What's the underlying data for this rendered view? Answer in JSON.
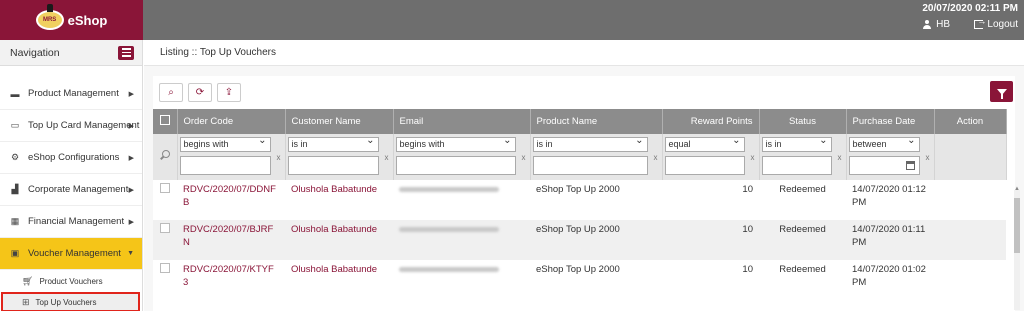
{
  "brand": {
    "badge": "MRS",
    "name": "eShop"
  },
  "header": {
    "datetime": "20/07/2020 02:11 PM",
    "user": "HB",
    "logout_label": "Logout"
  },
  "nav": {
    "title": "Navigation",
    "items": [
      {
        "label": "Product Management",
        "icon": "box-icon"
      },
      {
        "label": "Top Up Card Management",
        "icon": "card-icon"
      },
      {
        "label": "eShop Configurations",
        "icon": "gear-icon"
      },
      {
        "label": "Corporate Management",
        "icon": "chart-icon"
      },
      {
        "label": "Financial Management",
        "icon": "grid-icon"
      },
      {
        "label": "Voucher Management",
        "icon": "voucher-icon"
      }
    ],
    "sub_items": [
      {
        "label": "Product Vouchers",
        "icon": "cart-icon"
      },
      {
        "label": "Top Up Vouchers",
        "icon": "gift-icon"
      }
    ]
  },
  "breadcrumb": "Listing :: Top Up Vouchers",
  "table": {
    "columns": [
      "Order Code",
      "Customer Name",
      "Email",
      "Product Name",
      "Reward Points",
      "Status",
      "Purchase Date",
      "Action"
    ],
    "filters": [
      "begins with",
      "is in",
      "begins with",
      "is in",
      "equal",
      "is in",
      "between"
    ],
    "rows": [
      {
        "code": "RDVC/2020/07/DDNFB",
        "customer": "Olushola Babatunde",
        "product": "eShop Top Up 2000",
        "points": "10",
        "status": "Redeemed",
        "date": "14/07/2020 01:12 PM"
      },
      {
        "code": "RDVC/2020/07/BJRFN",
        "customer": "Olushola Babatunde",
        "product": "eShop Top Up 2000",
        "points": "10",
        "status": "Redeemed",
        "date": "14/07/2020 01:11 PM"
      },
      {
        "code": "RDVC/2020/07/KTYF3",
        "customer": "Olushola Babatunde",
        "product": "eShop Top Up 2000",
        "points": "10",
        "status": "Redeemed",
        "date": "14/07/2020 01:02 PM"
      }
    ]
  },
  "colors": {
    "brand": "#8a1538",
    "active_nav": "#f5c518",
    "header_bg": "#6e6e6e",
    "table_head": "#8c8c8c",
    "selection_outline": "#e0241b"
  }
}
